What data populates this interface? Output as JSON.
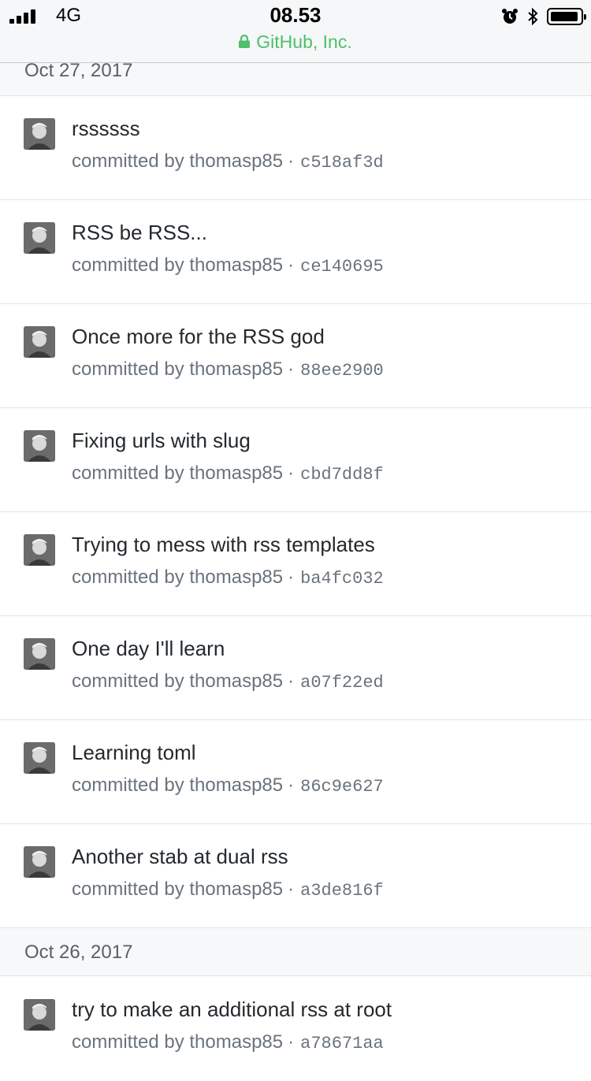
{
  "status_bar": {
    "carrier": "4G",
    "time": "08.53",
    "site": "GitHub, Inc."
  },
  "groups": [
    {
      "date": "Oct 27, 2017",
      "commits": [
        {
          "message": "rssssss",
          "byline": "committed by thomasp85",
          "sha": "c518af3d"
        },
        {
          "message": "RSS be RSS...",
          "byline": "committed by thomasp85",
          "sha": "ce140695"
        },
        {
          "message": "Once more for the RSS god",
          "byline": "committed by thomasp85",
          "sha": "88ee2900"
        },
        {
          "message": "Fixing urls with slug",
          "byline": "committed by thomasp85",
          "sha": "cbd7dd8f"
        },
        {
          "message": "Trying to mess with rss templates",
          "byline": "committed by thomasp85",
          "sha": "ba4fc032"
        },
        {
          "message": "One day I'll learn",
          "byline": "committed by thomasp85",
          "sha": "a07f22ed"
        },
        {
          "message": "Learning toml",
          "byline": "committed by thomasp85",
          "sha": "86c9e627"
        },
        {
          "message": "Another stab at dual rss",
          "byline": "committed by thomasp85",
          "sha": "a3de816f"
        }
      ]
    },
    {
      "date": "Oct 26, 2017",
      "commits": [
        {
          "message": "try to make an additional rss at root",
          "byline": "committed by thomasp85",
          "sha": "a78671aa"
        }
      ]
    }
  ],
  "separator": "·",
  "colors": {
    "secure_green": "#4cc06a",
    "header_bg": "#f6f8fa",
    "border": "#e1e4e8",
    "muted_text": "#6a737d"
  }
}
